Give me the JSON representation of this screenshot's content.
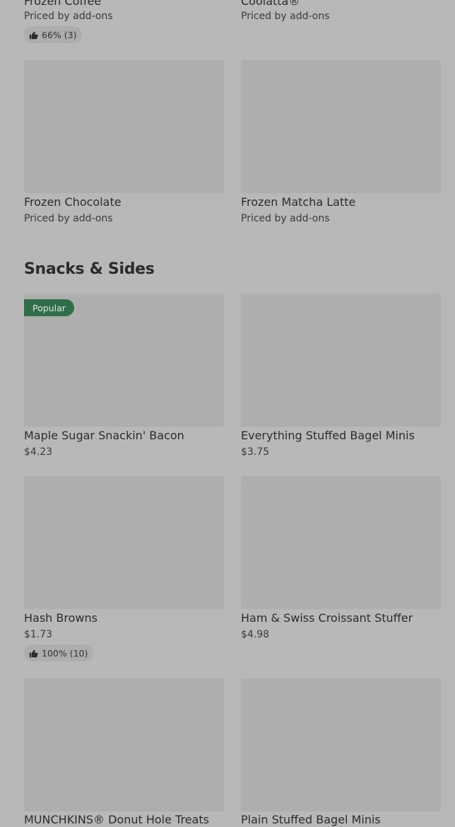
{
  "top_items": [
    {
      "name": "Frozen Coffee",
      "price": "Priced by add-ons",
      "rating": "66% (3)"
    },
    {
      "name": "Coolatta®",
      "price": "Priced by add-ons"
    }
  ],
  "frozen_row": [
    {
      "name": "Frozen Chocolate",
      "price": "Priced by add-ons"
    },
    {
      "name": "Frozen Matcha Latte",
      "price": "Priced by add-ons"
    }
  ],
  "section": {
    "title": "Snacks & Sides"
  },
  "snacks": [
    {
      "name": "Maple Sugar Snackin' Bacon",
      "price": "$4.23",
      "badge": "Popular"
    },
    {
      "name": "Everything Stuffed Bagel Minis",
      "price": "$3.75"
    },
    {
      "name": "Hash Browns",
      "price": "$1.73",
      "rating": "100% (10)"
    },
    {
      "name": "Ham & Swiss Croissant Stuffer",
      "price": "$4.98"
    },
    {
      "name": "MUNCHKINS® Donut Hole Treats"
    },
    {
      "name": "Plain Stuffed Bagel Minis"
    }
  ]
}
